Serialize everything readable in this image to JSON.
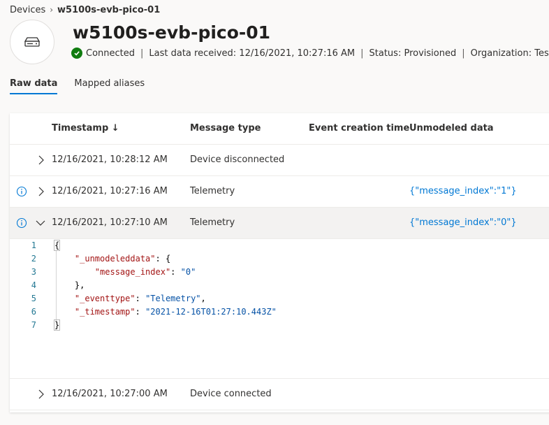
{
  "breadcrumb": {
    "root": "Devices",
    "current": "w5100s-evb-pico-01"
  },
  "device": {
    "name": "w5100s-evb-pico-01",
    "status": "Connected",
    "last_data": "Last data received: 12/16/2021, 10:27:16 AM",
    "provisioning": "Status: Provisioned",
    "organization": "Organization: Test app"
  },
  "tabs": [
    {
      "label": "Raw data",
      "active": true
    },
    {
      "label": "Mapped aliases",
      "active": false
    }
  ],
  "table": {
    "columns": [
      "Timestamp ↓",
      "Message type",
      "Event creation time",
      "Unmodeled data"
    ],
    "rows": [
      {
        "timestamp": "12/16/2021, 10:28:12 AM",
        "type": "Device disconnected",
        "event_time": "",
        "unmodeled": ""
      },
      {
        "timestamp": "12/16/2021, 10:27:16 AM",
        "type": "Telemetry",
        "event_time": "",
        "unmodeled": "{\"message_index\":\"1\"}"
      },
      {
        "timestamp": "12/16/2021, 10:27:10 AM",
        "type": "Telemetry",
        "event_time": "",
        "unmodeled": "{\"message_index\":\"0\"}"
      },
      {
        "timestamp": "12/16/2021, 10:27:00 AM",
        "type": "Device connected",
        "event_time": "",
        "unmodeled": ""
      }
    ]
  },
  "code": {
    "line_numbers": [
      "1",
      "2",
      "3",
      "4",
      "5",
      "6",
      "7"
    ],
    "l1": "{",
    "l2_key": "\"_unmodeleddata\"",
    "l2_rest": ": {",
    "l3_key": "\"message_index\"",
    "l3_sep": ": ",
    "l3_val": "\"0\"",
    "l4": "},",
    "l5_key": "\"_eventtype\"",
    "l5_sep": ": ",
    "l5_val": "\"Telemetry\"",
    "l5_end": ",",
    "l6_key": "\"_timestamp\"",
    "l6_sep": ": ",
    "l6_val": "\"2021-12-16T01:27:10.443Z\"",
    "l7": "}"
  },
  "colors": {
    "accent": "#0078d4",
    "success": "#107c10",
    "json_key": "#a31515",
    "json_string": "#0451a5"
  },
  "icons": {
    "device": "router-icon",
    "status": "check-circle-icon",
    "info": "info-icon",
    "expand": "chevron-right-icon",
    "collapse": "chevron-down-icon"
  }
}
